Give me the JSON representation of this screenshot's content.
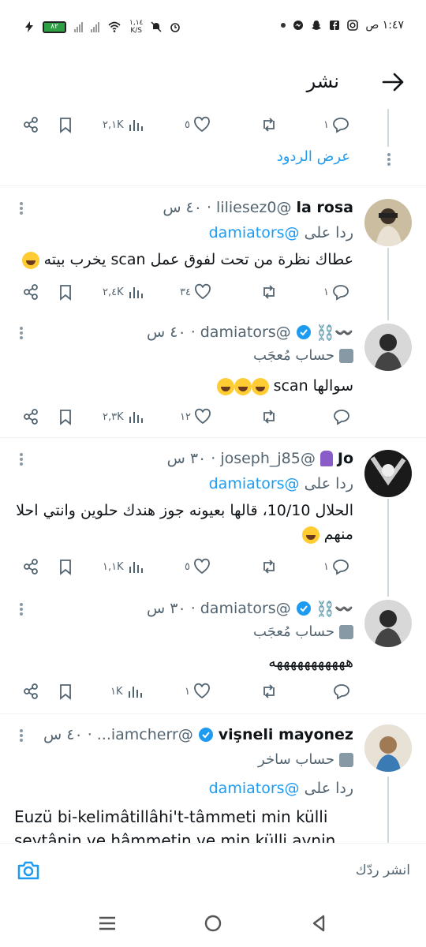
{
  "status_bar": {
    "time": "١:٤٧ ص",
    "battery_level": "٨٢",
    "net_speed_top": "١,١٤",
    "net_speed_unit": "K/S"
  },
  "header": {
    "title": "نشر"
  },
  "thread_top": {
    "actions": {
      "views": "٢,١K",
      "likes": "٥",
      "replies": "١"
    },
    "show_replies": "عرض الردود"
  },
  "tweets": [
    {
      "name": "la rosa",
      "handle": "@liliesez0",
      "time": "٤٠ س",
      "reply_prefix": "ردا على",
      "reply_to": "@damiators",
      "text": "عطاك نظرة من تحت لفوق عمل scan يخرب بيته",
      "actions": {
        "views": "٢,٤K",
        "likes": "٣٤",
        "replies": "١"
      }
    },
    {
      "name": "",
      "handle": "@damiators",
      "time": "٤٠ س",
      "label": "حساب مُعجَب",
      "text": "سوالها scan",
      "actions": {
        "views": "٢,٣K",
        "likes": "١٢",
        "replies": ""
      }
    },
    {
      "name": "Jo",
      "handle": "@joseph_j85",
      "time": "٣٠ س",
      "reply_prefix": "ردا على",
      "reply_to": "@damiators",
      "text": "الحلال 10/10، قالها بعيونه جوز هندك حلوين وانتي احلا منهم",
      "actions": {
        "views": "١,١K",
        "likes": "٥",
        "replies": "١"
      }
    },
    {
      "name": "",
      "handle": "@damiators",
      "time": "٣٠ س",
      "label": "حساب مُعجَب",
      "text": "هههههههههههه",
      "actions": {
        "views": "١K",
        "likes": "١",
        "replies": ""
      }
    },
    {
      "name": "vişneli mayonez",
      "handle": "@iamcherr...",
      "time": "٤٠ س",
      "label": "حساب ساخر",
      "reply_prefix": "ردا على",
      "reply_to": "@damiators",
      "text": "Euzü bi-kelimâtillâhi't-tâmmeti min külli şeytânin ve hâmmetin ve min külli aynin"
    }
  ],
  "composer": {
    "placeholder": "انشر ردّك"
  },
  "colors": {
    "accent": "#1d9bf0",
    "muted": "#536471",
    "battery": "#2ea043"
  }
}
